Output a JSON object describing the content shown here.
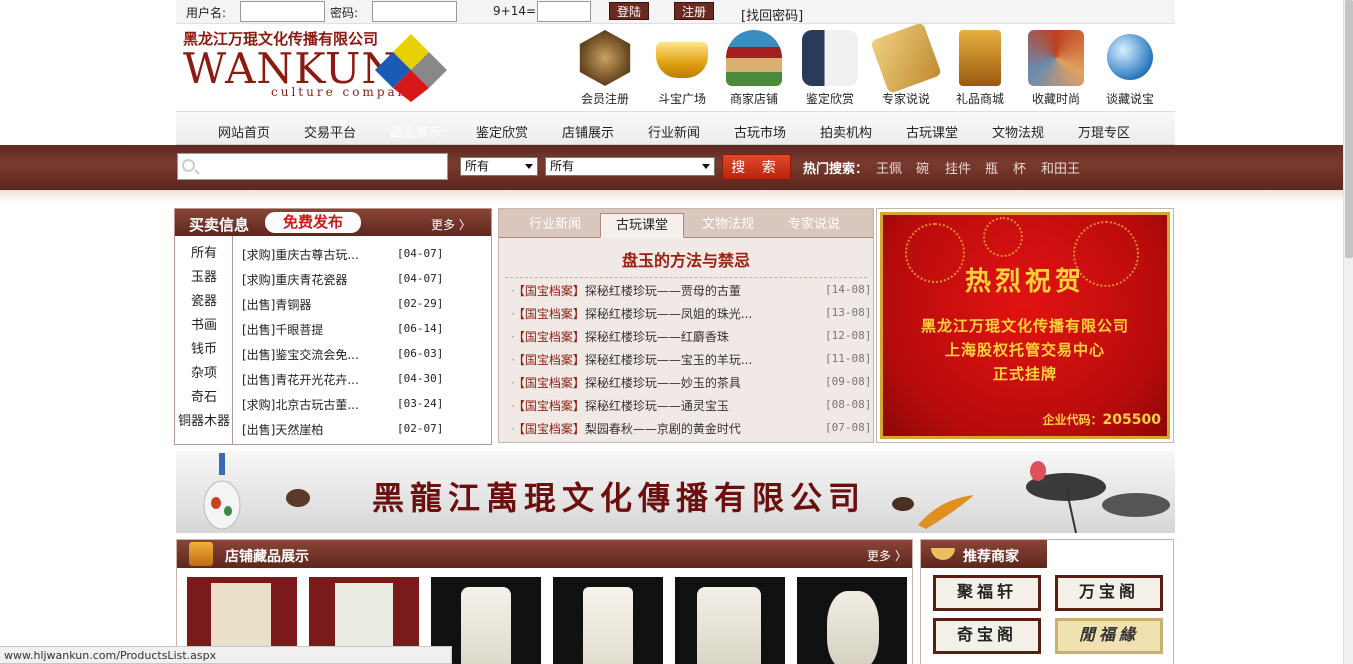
{
  "login": {
    "username_label": "用户名:",
    "username_value": "",
    "password_label": "密码:",
    "password_value": "",
    "captcha_text": "9+14=",
    "captcha_value": "",
    "login_button": "登陆",
    "register_button": "注册",
    "forgot_link": "[找回密码]"
  },
  "logo": {
    "cn": "黑龙江万琨文化传播有限公司",
    "en": "WANKUN",
    "sub": "culture company"
  },
  "top_icons": [
    {
      "label": "会员注册",
      "icon": "member-register-icon"
    },
    {
      "label": "斗宝广场",
      "icon": "gold-ingot-icon"
    },
    {
      "label": "商家店铺",
      "icon": "shop-building-icon"
    },
    {
      "label": "鉴定欣赏",
      "icon": "vase-icon"
    },
    {
      "label": "专家说说",
      "icon": "scroll-icon"
    },
    {
      "label": "礼品商城",
      "icon": "gift-box-icon"
    },
    {
      "label": "收藏时尚",
      "icon": "collection-icon"
    },
    {
      "label": "谈藏说宝",
      "icon": "chat-icon"
    }
  ],
  "nav": [
    "网站首页",
    "交易平台",
    "藏品展示",
    "鉴定欣赏",
    "店铺展示",
    "行业新闻",
    "古玩市场",
    "拍卖机构",
    "古玩课堂",
    "文物法规",
    "万琨专区"
  ],
  "search": {
    "placeholder": "",
    "select1": "所有",
    "select2": "所有",
    "button": "搜 索",
    "hot_label": "热门搜索：",
    "hot_keywords": [
      "王佩",
      "碗",
      "挂件",
      "瓶",
      "杯",
      "和田王"
    ]
  },
  "buy_sell": {
    "title": "买卖信息",
    "free_post": "免费发布",
    "more": "更多 〉",
    "categories": [
      "所有",
      "玉器",
      "瓷器",
      "书画",
      "钱币",
      "杂项",
      "奇石",
      "铜器木器"
    ],
    "posts": [
      {
        "title": "[求购]重庆古尊古玩...",
        "date": "[04-07]"
      },
      {
        "title": "[求购]重庆青花瓷器",
        "date": "[04-07]"
      },
      {
        "title": "[出售]青铜器",
        "date": "[02-29]"
      },
      {
        "title": "[出售]千眼菩提",
        "date": "[06-14]"
      },
      {
        "title": "[出售]鉴宝交流会免...",
        "date": "[06-03]"
      },
      {
        "title": "[出售]青花开光花卉...",
        "date": "[04-30]"
      },
      {
        "title": "[求购]北京古玩古董...",
        "date": "[03-24]"
      },
      {
        "title": "[出售]天然崖柏",
        "date": "[02-07]"
      }
    ]
  },
  "news": {
    "tabs": [
      "行业新闻",
      "古玩课堂",
      "文物法规",
      "专家说说"
    ],
    "active_tab": 1,
    "headline": "盘玉的方法与禁忌",
    "items": [
      {
        "tag": "【国宝档案】",
        "title": "探秘红楼珍玩——贾母的古董",
        "date": "[14-08]"
      },
      {
        "tag": "【国宝档案】",
        "title": "探秘红楼珍玩——凤姐的珠光...",
        "date": "[13-08]"
      },
      {
        "tag": "【国宝档案】",
        "title": "探秘红楼珍玩——红麝香珠",
        "date": "[12-08]"
      },
      {
        "tag": "【国宝档案】",
        "title": "探秘红楼珍玩——宝玉的羊玩...",
        "date": "[11-08]"
      },
      {
        "tag": "【国宝档案】",
        "title": "探秘红楼珍玩——妙玉的茶具",
        "date": "[09-08]"
      },
      {
        "tag": "【国宝档案】",
        "title": "探秘红楼珍玩——通灵宝玉",
        "date": "[08-08]"
      },
      {
        "tag": "【国宝档案】",
        "title": "梨园春秋——京剧的黄金时代",
        "date": "[07-08]"
      }
    ]
  },
  "red_banner": {
    "heading": "热烈祝贺",
    "line1": "黑龙江万琨文化传播有限公司",
    "line2": "上海股权托管交易中心",
    "line3": "正式挂牌",
    "code_label": "企业代码：",
    "code_value": "205500"
  },
  "big_banner": {
    "text": "黑龍江萬琨文化傳播有限公司"
  },
  "store": {
    "title": "店铺藏品展示",
    "more": "更多 〉"
  },
  "recommended": {
    "title": "推荐商家",
    "plaques": [
      "聚福轩",
      "万宝阁",
      "奇宝阁",
      "閒福緣"
    ]
  },
  "status_bar": "www.hljwankun.com/ProductsList.aspx",
  "colors": {
    "brand": "#8b1a10",
    "band": "#6a3026",
    "accent_red": "#d01818",
    "gold": "#ffd23a"
  }
}
